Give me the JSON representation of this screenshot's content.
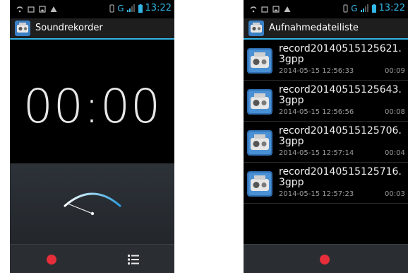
{
  "colors": {
    "accent": "#33b5e5",
    "record": "#e62e3a"
  },
  "left": {
    "status": {
      "network": "G",
      "time": "13:22"
    },
    "title": "Soundrekorder",
    "timer": "00:00",
    "icons": {
      "app": "recorder-app-icon",
      "record": "record-icon",
      "list": "list-icon",
      "meter": "vu-meter-icon"
    }
  },
  "right": {
    "status": {
      "network": "G",
      "time": "13:22"
    },
    "title": "Aufnahmedateiliste",
    "files": [
      {
        "name": "record20140515125621.3gpp",
        "date": "2014-05-15 12:56:33",
        "duration": "00:09"
      },
      {
        "name": "record20140515125643.3gpp",
        "date": "2014-05-15 12:56:56",
        "duration": "00:08"
      },
      {
        "name": "record20140515125706.3gpp",
        "date": "2014-05-15 12:57:14",
        "duration": "00:04"
      },
      {
        "name": "record20140515125716.3gpp",
        "date": "2014-05-15 12:57:23",
        "duration": "00:03"
      }
    ]
  }
}
